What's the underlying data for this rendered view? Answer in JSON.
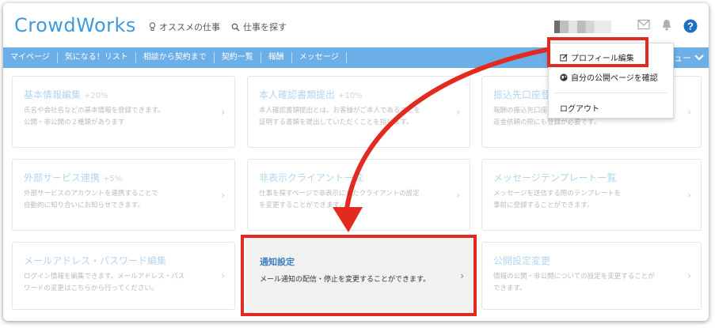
{
  "header": {
    "logo": "CrowdWorks",
    "nav": [
      {
        "label": "オススメの仕事",
        "icon": "lightbulb-icon"
      },
      {
        "label": "仕事を探す",
        "icon": "search-icon"
      }
    ],
    "icons": [
      "mail-icon",
      "bell-icon",
      "help-icon"
    ]
  },
  "navbar": {
    "items": [
      "マイページ",
      "気になる！リスト",
      "相談から契約まで",
      "契約一覧",
      "報酬",
      "メッセージ"
    ],
    "menu_label": "ニュー"
  },
  "cards": [
    {
      "title": "基本情報編集",
      "pct": "+20%",
      "desc1": "氏名や会社名などの基本情報を登録できます。",
      "desc2": "公開・非公開の２種類があります"
    },
    {
      "title": "本人確認書類提出",
      "pct": "+10%",
      "desc1": "本人確認書類提出とは、お客様がご本人であることを",
      "desc2": "証明する書類を提出していただくことを指します。"
    },
    {
      "title": "振込先口座登録",
      "pct": "",
      "desc1": "報酬の振込先口座を登録できます。",
      "desc2": "返金依頼の際にも登録が必要です。"
    },
    {
      "title": "外部サービス連携",
      "pct": "+5%",
      "desc1": "外部サービスのアカウントを連携することで",
      "desc2": "自動的に知り合いにお知らせできます。"
    },
    {
      "title": "非表示クライアント一覧",
      "pct": "",
      "desc1": "仕事を探すページで非表示にしたクライアントの設定",
      "desc2": "を変更することができます。"
    },
    {
      "title": "メッセージテンプレート一覧",
      "pct": "",
      "desc1": "メッセージを送信する際のテンプレートを",
      "desc2": "事前に登録することができます。"
    },
    {
      "title": "メールアドレス・パスワード編集",
      "pct": "",
      "desc1": "ログイン情報を編集できます。メールアドレス・パス",
      "desc2": "ワードの変更はこちらから行ってください。"
    },
    {
      "title": "通知設定",
      "pct": "",
      "desc1": "メール通知の配信・停止を変更することができます。",
      "desc2": ""
    },
    {
      "title": "公開設定変更",
      "pct": "",
      "desc1": "情報の公開・非公開についての設定を変更することが",
      "desc2": "できます。"
    }
  ],
  "dropdown": {
    "items": [
      {
        "label": "プロフィール編集",
        "icon": "edit-icon"
      },
      {
        "label": "自分の公開ページを確認",
        "icon": "globe-icon"
      },
      {
        "label": "ログアウト",
        "icon": ""
      }
    ]
  },
  "colors": {
    "accent": "#3b9bdc",
    "navbar": "#6caee6",
    "annotation": "#e32a20"
  }
}
